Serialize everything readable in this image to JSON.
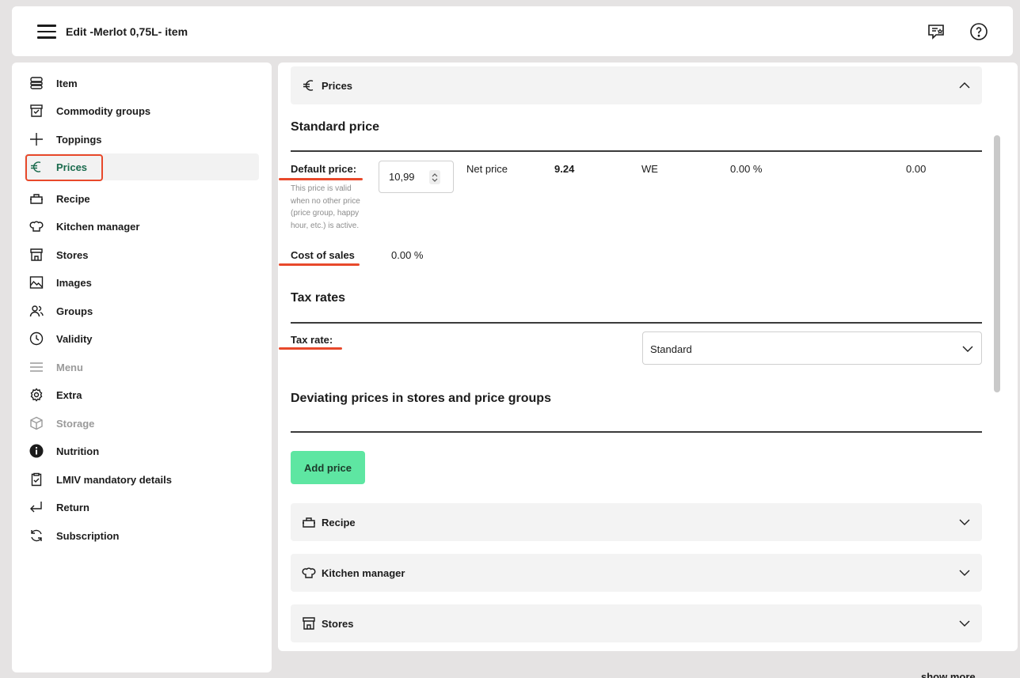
{
  "header": {
    "title": "Edit -Merlot 0,75L- item",
    "icons": [
      "menu-icon",
      "feedback-icon",
      "help-icon"
    ]
  },
  "sidebar": {
    "items": [
      {
        "label": "Item",
        "icon": "item-icon"
      },
      {
        "label": "Commodity groups",
        "icon": "box-icon"
      },
      {
        "label": "Toppings",
        "icon": "plus-icon"
      },
      {
        "label": "Prices",
        "icon": "euro-icon"
      },
      {
        "label": "Recipe",
        "icon": "pot-icon"
      },
      {
        "label": "Kitchen manager",
        "icon": "chef-hat-icon"
      },
      {
        "label": "Stores",
        "icon": "store-icon"
      },
      {
        "label": "Images",
        "icon": "image-icon"
      },
      {
        "label": "Groups",
        "icon": "users-icon"
      },
      {
        "label": "Validity",
        "icon": "clock-icon"
      },
      {
        "label": "Menu",
        "icon": "menu-lines-icon"
      },
      {
        "label": "Extra",
        "icon": "gear-icon"
      },
      {
        "label": "Storage",
        "icon": "cube-icon"
      },
      {
        "label": "Nutrition",
        "icon": "info-icon"
      },
      {
        "label": "LMIV mandatory details",
        "icon": "clipboard-check-icon"
      },
      {
        "label": "Return",
        "icon": "return-icon"
      },
      {
        "label": "Subscription",
        "icon": "refresh-icon"
      }
    ]
  },
  "main": {
    "prices_header": "Prices",
    "standard_price": {
      "title": "Standard price",
      "default_price_label": "Default price:",
      "default_price_value": "10,99",
      "hint": "This price is valid when no other price (price group, happy hour, etc.) is active.",
      "net_price_label": "Net price",
      "net_price_value": "9.24",
      "we_label": "WE",
      "we_percent": "0.00 %",
      "we_value": "0.00",
      "cost_of_sales_label": "Cost of sales",
      "cost_of_sales_value": "0.00 %"
    },
    "tax_rates": {
      "title": "Tax rates",
      "tax_rate_label": "Tax rate:",
      "tax_rate_value": "Standard"
    },
    "deviating": {
      "title": "Deviating prices in stores and price groups",
      "add_price_label": "Add price"
    },
    "sections": [
      {
        "label": "Recipe",
        "icon": "pot-icon"
      },
      {
        "label": "Kitchen manager",
        "icon": "chef-hat-icon"
      },
      {
        "label": "Stores",
        "icon": "store-icon"
      }
    ]
  },
  "footer": {
    "show_more": "show more"
  },
  "colors": {
    "accent_green": "#5ee6a2",
    "active_text": "#1a6b4d",
    "highlight_red": "#e8492b"
  }
}
